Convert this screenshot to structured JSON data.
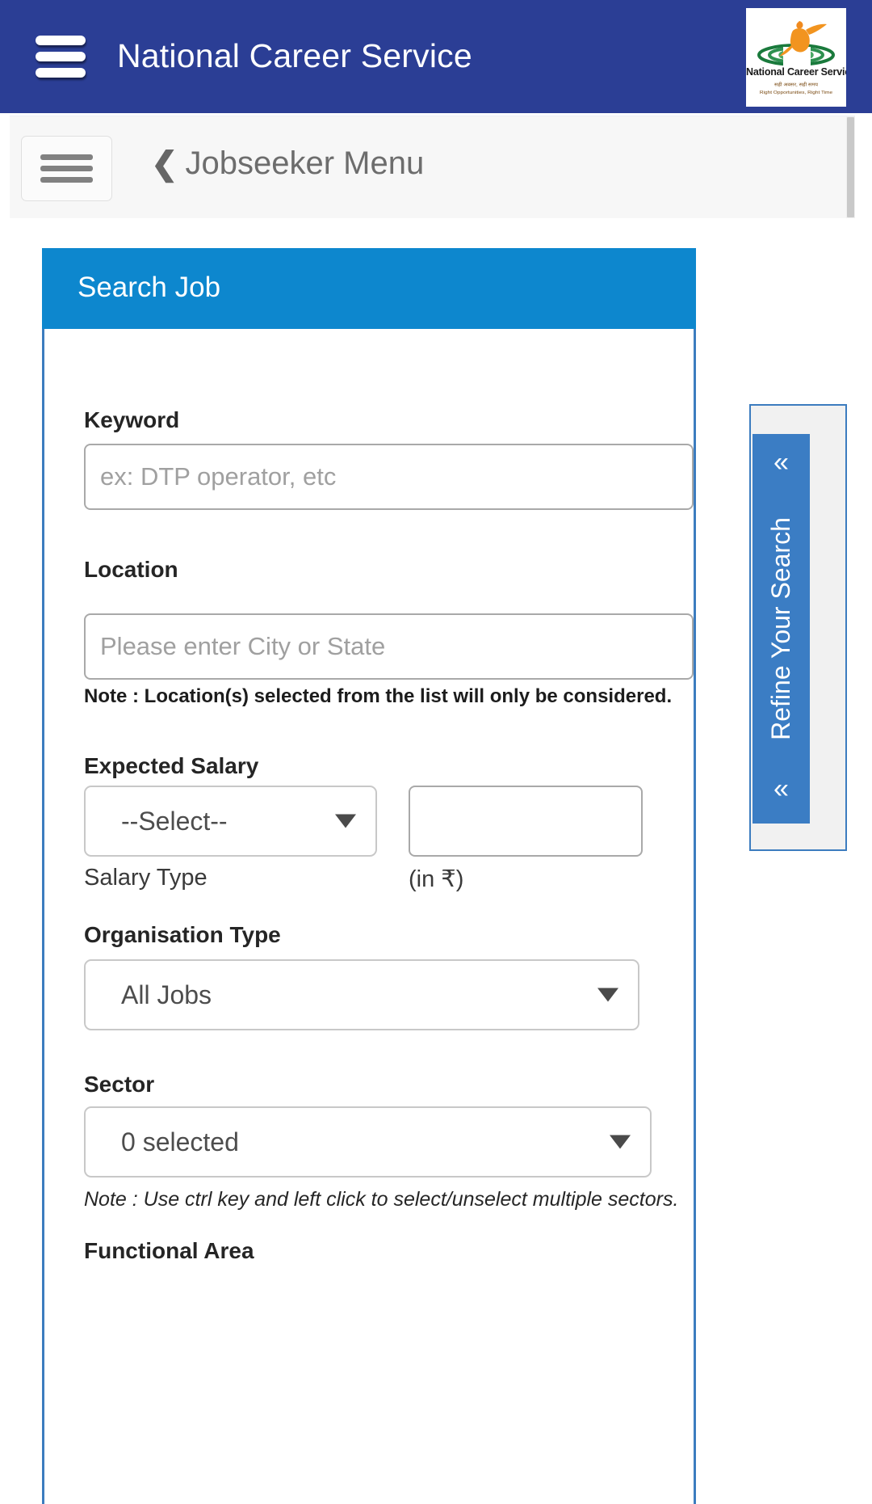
{
  "header": {
    "title": "National Career Service",
    "menu_icon": "hamburger-icon",
    "logo": {
      "name": "National Career Service",
      "tagline_hi": "सही अवसर, सही समय",
      "tagline_en": "Right Opportunities, Right Time"
    },
    "colors": {
      "background": "#2b3e95"
    }
  },
  "menu_bar": {
    "toggle_icon": "hamburger-icon",
    "back_icon": "chevron-left-icon",
    "label": "Jobseeker Menu"
  },
  "card": {
    "title": "Search Job",
    "header_color": "#0d87ce",
    "border_color": "#3c7cbf"
  },
  "form": {
    "keyword": {
      "label": "Keyword",
      "value": "",
      "placeholder": "ex: DTP operator, etc"
    },
    "location": {
      "label": "Location",
      "value": "",
      "placeholder": "Please enter City or State",
      "note": "Note : Location(s) selected from the list will only be considered."
    },
    "expected_salary": {
      "label": "Expected Salary",
      "salary_type": {
        "selected": "--Select--",
        "caption": "Salary Type",
        "arrow_icon": "chevron-down-icon"
      },
      "amount": {
        "value": "",
        "caption": "(in ₹)"
      }
    },
    "organisation_type": {
      "label": "Organisation Type",
      "selected": "All Jobs",
      "arrow_icon": "chevron-down-icon"
    },
    "sector": {
      "label": "Sector",
      "selected": "0 selected",
      "arrow_icon": "chevron-down-icon",
      "note": "Note : Use ctrl key and left click to select/unselect multiple sectors."
    },
    "functional_area": {
      "label": "Functional Area"
    }
  },
  "refine": {
    "label": "Refine Your Search",
    "chevron_top": "«",
    "chevron_bottom": "«",
    "color": "#3b7dc4"
  }
}
